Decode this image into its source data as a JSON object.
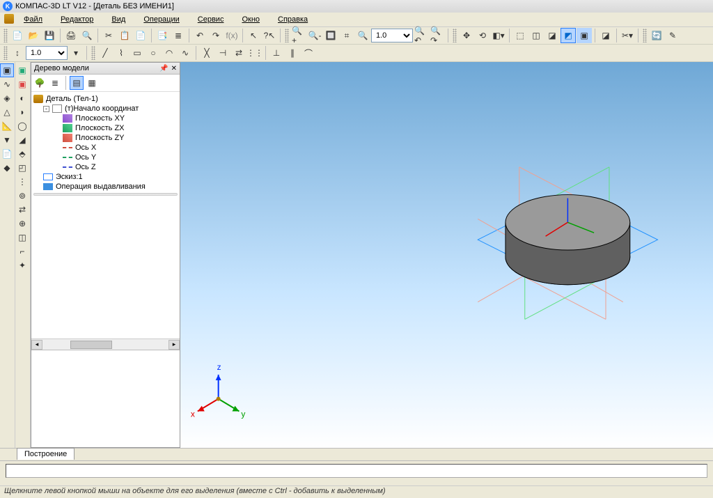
{
  "title": "КОМПАС-3D LT V12 - [Деталь БЕЗ ИМЕНИ1]",
  "menu": {
    "file": "Файл",
    "edit": "Редактор",
    "view": "Вид",
    "ops": "Операции",
    "service": "Сервис",
    "window": "Окно",
    "help": "Справка"
  },
  "zoom_list": "1.0",
  "scale_list": "1.0",
  "panel": {
    "title": "Дерево модели"
  },
  "tree": {
    "root": "Деталь (Тел-1)",
    "origin": "(т)Начало координат",
    "pxy": "Плоскость XY",
    "pzx": "Плоскость ZX",
    "pzy": "Плоскость ZY",
    "ax": "Ось X",
    "ay": "Ось Y",
    "az": "Ось Z",
    "sketch": "Эскиз:1",
    "extr": "Операция выдавливания"
  },
  "tab": "Построение",
  "axes": {
    "x": "x",
    "y": "y",
    "z": "z"
  },
  "status": "Щелкните левой кнопкой мыши на объекте для его выделения (вместе с Ctrl - добавить к выделенным)"
}
